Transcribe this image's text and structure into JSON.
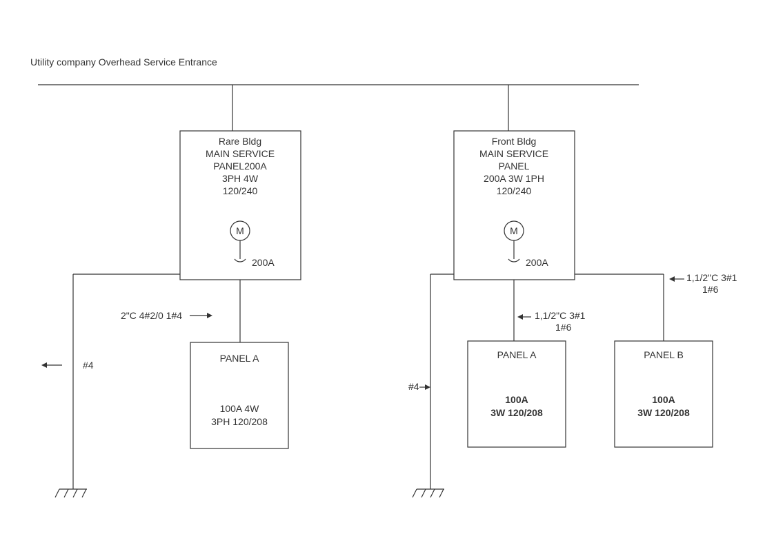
{
  "title": "Utility company Overhead Service Entrance",
  "rare_bldg": {
    "l1": "Rare Bldg",
    "l2": "MAIN SERVICE",
    "l3": "PANEL200A",
    "l4": "3PH 4W",
    "l5": "120/240",
    "m": "M",
    "breaker": "200A"
  },
  "front_bldg": {
    "l1": "Front Bldg",
    "l2": "MAIN SERVICE",
    "l3": "PANEL",
    "l4": "200A 3W 1PH",
    "l5": "120/240",
    "m": "M",
    "breaker": "200A"
  },
  "feeder1": "2\"C 4#2/0 1#4",
  "feeder2a": "1,1/2\"C 3#1",
  "feeder2b": "1#6",
  "feeder3a": "1,1/2\"C 3#1",
  "feeder3b": "1#6",
  "ground1": "#4",
  "ground2": "#4",
  "panel_a_left": {
    "name": "PANEL A",
    "l1": "100A 4W",
    "l2": "3PH 120/208"
  },
  "panel_a_right": {
    "name": "PANEL A",
    "l1": "100A",
    "l2": "3W 120/208"
  },
  "panel_b": {
    "name": "PANEL B",
    "l1": "100A",
    "l2": "3W 120/208"
  }
}
